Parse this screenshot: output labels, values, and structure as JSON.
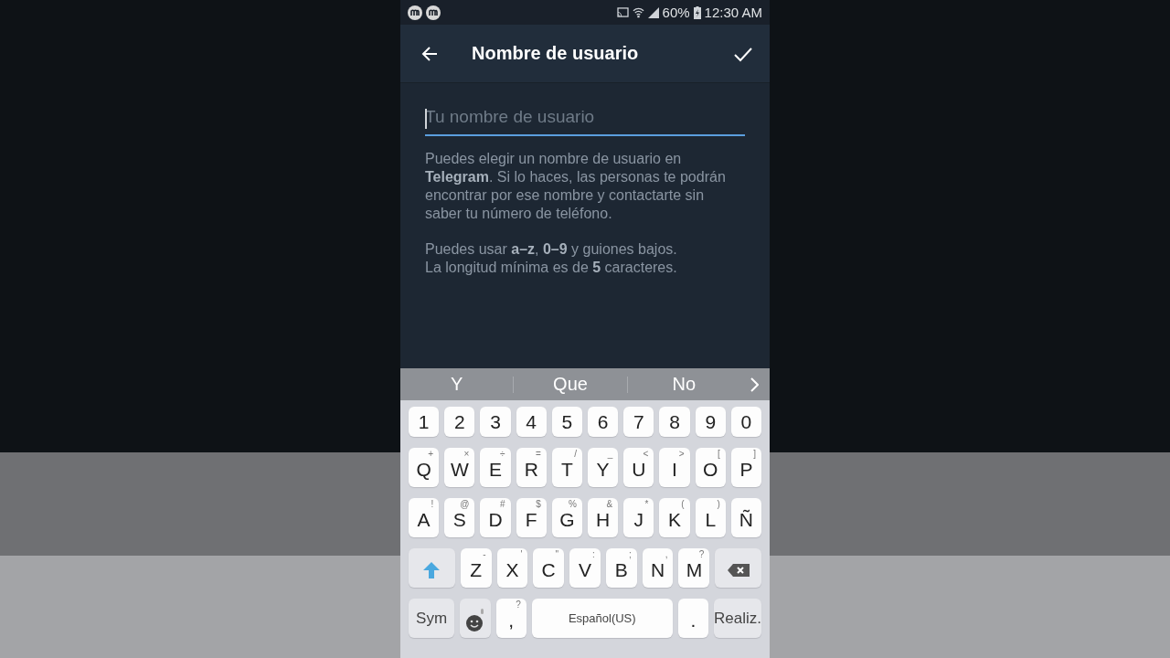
{
  "status_bar": {
    "battery": "60%",
    "time": "12:30 AM"
  },
  "header": {
    "title": "Nombre de usuario"
  },
  "field": {
    "placeholder": "Tu nombre de usuario",
    "focused": true
  },
  "description": [
    "Puedes elegir un nombre de usuario en **Telegram**. Si lo haces, las personas te podrán encontrar por ese nombre y contactarte sin saber tu número de teléfono.",
    "Puedes usar **a–z**, **0–9** y guiones bajos.\nLa longitud mínima es de **5** caracteres."
  ],
  "suggestions": [
    "Y",
    "Que",
    "No"
  ],
  "keyboard": [
    [
      {
        "kind": "char",
        "label": "1"
      },
      {
        "kind": "char",
        "label": "2"
      },
      {
        "kind": "char",
        "label": "3"
      },
      {
        "kind": "char",
        "label": "4"
      },
      {
        "kind": "char",
        "label": "5"
      },
      {
        "kind": "char",
        "label": "6"
      },
      {
        "kind": "char",
        "label": "7"
      },
      {
        "kind": "char",
        "label": "8"
      },
      {
        "kind": "char",
        "label": "9"
      },
      {
        "kind": "char",
        "label": "0"
      }
    ],
    [
      {
        "kind": "char",
        "label": "Q",
        "hint": "+"
      },
      {
        "kind": "char",
        "label": "W",
        "hint": "×"
      },
      {
        "kind": "char",
        "label": "E",
        "hint": "÷"
      },
      {
        "kind": "char",
        "label": "R",
        "hint": "="
      },
      {
        "kind": "char",
        "label": "T",
        "hint": "/"
      },
      {
        "kind": "char",
        "label": "Y",
        "hint": "_"
      },
      {
        "kind": "char",
        "label": "U",
        "hint": "<"
      },
      {
        "kind": "char",
        "label": "I",
        "hint": ">"
      },
      {
        "kind": "char",
        "label": "O",
        "hint": "["
      },
      {
        "kind": "char",
        "label": "P",
        "hint": "]"
      }
    ],
    [
      {
        "kind": "char",
        "label": "A",
        "hint": "!"
      },
      {
        "kind": "char",
        "label": "S",
        "hint": "@"
      },
      {
        "kind": "char",
        "label": "D",
        "hint": "#"
      },
      {
        "kind": "char",
        "label": "F",
        "hint": "$"
      },
      {
        "kind": "char",
        "label": "G",
        "hint": "%"
      },
      {
        "kind": "char",
        "label": "H",
        "hint": "&"
      },
      {
        "kind": "char",
        "label": "J",
        "hint": "*"
      },
      {
        "kind": "char",
        "label": "K",
        "hint": "("
      },
      {
        "kind": "char",
        "label": "L",
        "hint": ")"
      },
      {
        "kind": "char",
        "label": "Ñ"
      }
    ],
    [
      {
        "kind": "shift"
      },
      {
        "kind": "char",
        "label": "Z",
        "hint": "-"
      },
      {
        "kind": "char",
        "label": "X",
        "hint": "'"
      },
      {
        "kind": "char",
        "label": "C",
        "hint": "\""
      },
      {
        "kind": "char",
        "label": "V",
        "hint": ":"
      },
      {
        "kind": "char",
        "label": "B",
        "hint": ";"
      },
      {
        "kind": "char",
        "label": "N",
        "hint": ","
      },
      {
        "kind": "char",
        "label": "M",
        "hint": "?"
      },
      {
        "kind": "backspace"
      }
    ],
    [
      {
        "kind": "function",
        "label": "Sym"
      },
      {
        "kind": "emoji"
      },
      {
        "kind": "char",
        "label": ",",
        "hint": "?"
      },
      {
        "kind": "space",
        "label": "Español(US)"
      },
      {
        "kind": "char",
        "label": "."
      },
      {
        "kind": "function",
        "label": "Realiz."
      }
    ]
  ]
}
